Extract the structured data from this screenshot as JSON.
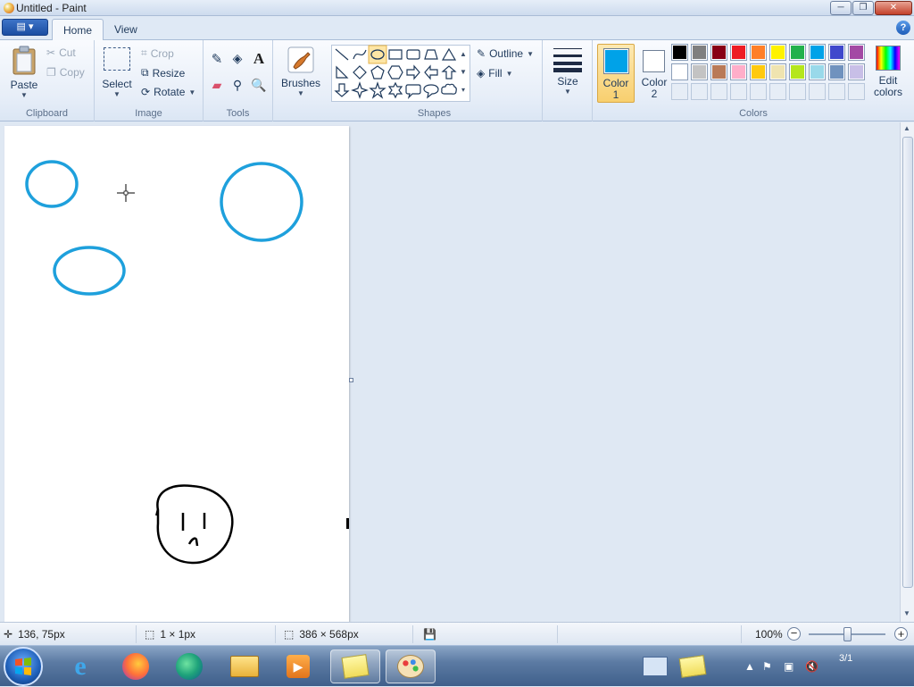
{
  "window": {
    "title": "Untitled - Paint",
    "min": "─",
    "max": "❐",
    "close": "✕"
  },
  "tabs": {
    "app_menu": "▤ ▾",
    "home": "Home",
    "view": "View",
    "help": "?"
  },
  "clipboard": {
    "paste": "Paste",
    "cut": "Cut",
    "copy": "Copy",
    "group": "Clipboard"
  },
  "image": {
    "select": "Select",
    "crop": "Crop",
    "resize": "Resize",
    "rotate": "Rotate",
    "group": "Image"
  },
  "tools": {
    "group": "Tools",
    "text_tool": "A"
  },
  "brushes": {
    "label": "Brushes"
  },
  "shapes": {
    "group": "Shapes",
    "outline": "Outline",
    "fill": "Fill"
  },
  "size": {
    "label": "Size"
  },
  "colors": {
    "group": "Colors",
    "color1_line1": "Color",
    "color1_line2": "1",
    "color2_line1": "Color",
    "color2_line2": "2",
    "edit_line1": "Edit",
    "edit_line2": "colors",
    "color1": "#00a2e8",
    "color2": "#ffffff",
    "palette_row1": [
      "#000000",
      "#7f7f7f",
      "#880015",
      "#ed1c24",
      "#ff7f27",
      "#fff200",
      "#22b14c",
      "#00a2e8",
      "#3f48cc",
      "#a349a4"
    ],
    "palette_row2": [
      "#ffffff",
      "#c3c3c3",
      "#b97a57",
      "#ffaec9",
      "#ffc90e",
      "#efe4b0",
      "#b5e61d",
      "#99d9ea",
      "#7092be",
      "#c8bfe7"
    ]
  },
  "status": {
    "cursor_pos": "136, 75px",
    "selection_size": "1 × 1px",
    "image_size": "386 × 568px",
    "zoom": "100%"
  },
  "taskbar": {
    "clock_time": "",
    "clock_date": "3/1"
  }
}
